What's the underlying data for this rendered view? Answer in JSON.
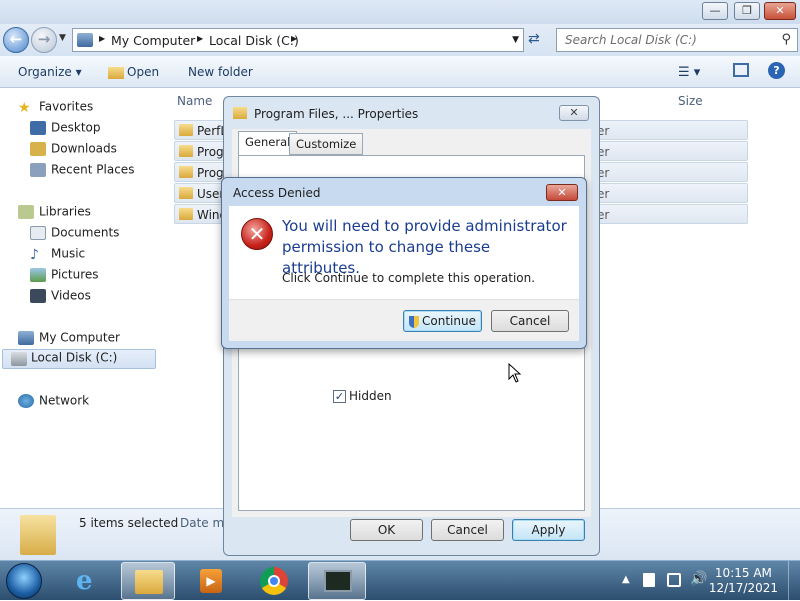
{
  "explorer": {
    "caption_buttons": {
      "minimize": "—",
      "maximize": "❐",
      "close": "✕"
    },
    "breadcrumb": [
      "My Computer",
      "Local Disk (C:)"
    ],
    "search_placeholder": "Search Local Disk (C:)",
    "toolbar": {
      "organize": "Organize",
      "open": "Open",
      "new_folder": "New folder"
    },
    "nav": {
      "favorites": "Favorites",
      "fav_items": [
        "Desktop",
        "Downloads",
        "Recent Places"
      ],
      "libraries": "Libraries",
      "lib_items": [
        "Documents",
        "Music",
        "Pictures",
        "Videos"
      ],
      "computer": "My Computer",
      "local_disk": "Local Disk (C:)",
      "network": "Network"
    },
    "columns": {
      "name": "Name",
      "size": "Size"
    },
    "files": [
      {
        "name": "PerfL",
        "type": "er"
      },
      {
        "name": "Prog",
        "type": "er"
      },
      {
        "name": "Prog",
        "type": "er"
      },
      {
        "name": "User",
        "type": "er"
      },
      {
        "name": "Wind",
        "type": "er"
      }
    ],
    "details": {
      "selected": "5 items selected",
      "date_label": "Date mo"
    }
  },
  "properties": {
    "title": "Program Files, ... Properties",
    "close": "✕",
    "tabs": [
      "General",
      "Customize"
    ],
    "hidden_label": "Hidden",
    "hidden_checked": true,
    "buttons": {
      "ok": "OK",
      "cancel": "Cancel",
      "apply": "Apply"
    }
  },
  "denied": {
    "title": "Access Denied",
    "close": "✕",
    "message": "You will need to provide administrator permission to change these attributes.",
    "sub": "Click Continue to complete this operation.",
    "continue": "Continue",
    "cancel": "Cancel"
  },
  "taskbar": {
    "time": "10:15 AM",
    "date": "12/17/2021"
  },
  "colors": {
    "accent": "#1a3d8f",
    "error": "#c8231b"
  }
}
